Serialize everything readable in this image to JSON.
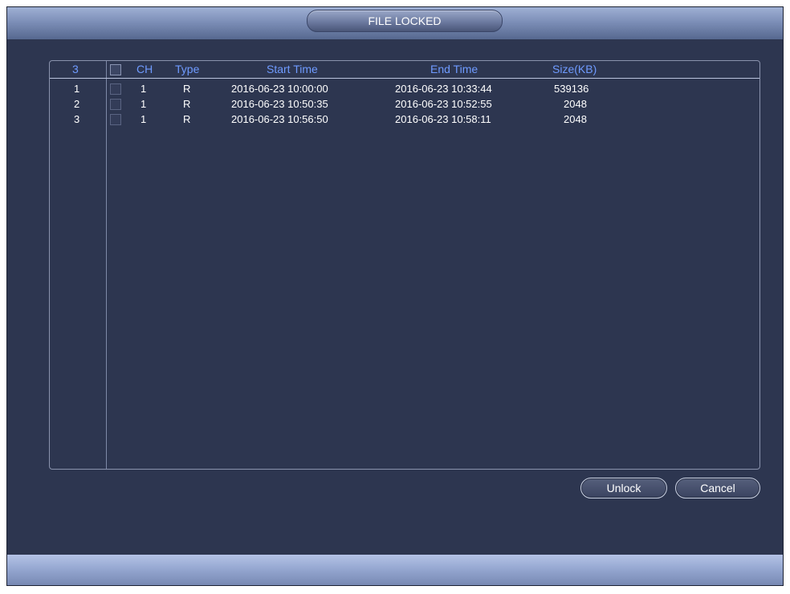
{
  "dialog": {
    "title": "FILE LOCKED"
  },
  "file_list": {
    "header": {
      "count": "3",
      "ch": "CH",
      "type": "Type",
      "start_time": "Start Time",
      "end_time": "End Time",
      "size": "Size(KB)"
    },
    "rows": [
      {
        "index": "1",
        "checked": false,
        "ch": "1",
        "type": "R",
        "start_time": "2016-06-23 10:00:00",
        "end_time": "2016-06-23 10:33:44",
        "size": "539136"
      },
      {
        "index": "2",
        "checked": false,
        "ch": "1",
        "type": "R",
        "start_time": "2016-06-23 10:50:35",
        "end_time": "2016-06-23 10:52:55",
        "size": "2048"
      },
      {
        "index": "3",
        "checked": false,
        "ch": "1",
        "type": "R",
        "start_time": "2016-06-23 10:56:50",
        "end_time": "2016-06-23 10:58:11",
        "size": "2048"
      }
    ]
  },
  "buttons": {
    "unlock": "Unlock",
    "cancel": "Cancel"
  },
  "colors": {
    "background": "#2d3650",
    "header_text": "#6f9bff",
    "title_bar": "#7d8fb8"
  }
}
